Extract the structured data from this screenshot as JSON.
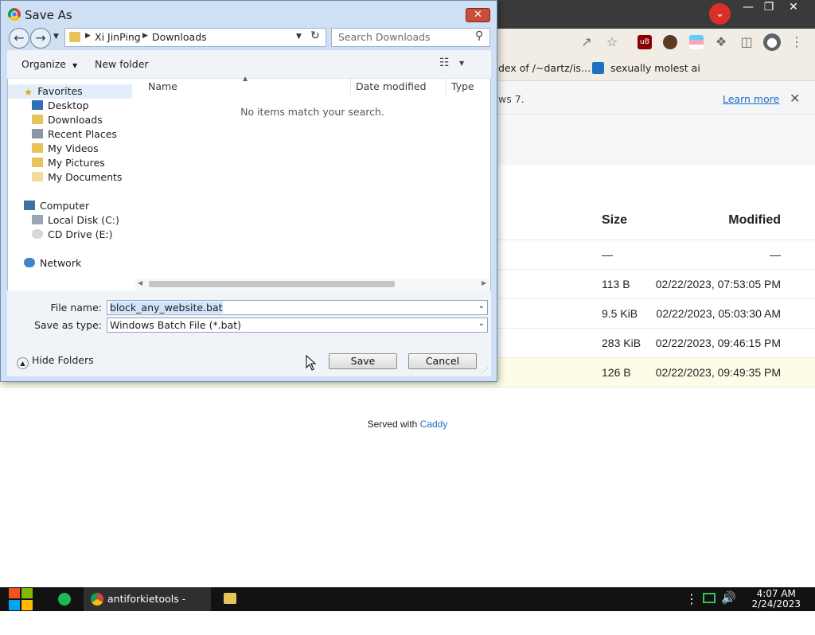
{
  "browser": {
    "bookmarks": [
      "dex of /~dartz/is…",
      "sexually molest ai"
    ],
    "infobar": {
      "text": "ws 7.",
      "link": "Learn more"
    },
    "table": {
      "headers": {
        "size": "Size",
        "modified": "Modified"
      },
      "rows": [
        {
          "size": "—",
          "modified": "—"
        },
        {
          "size": "113 B",
          "modified": "02/22/2023, 07:53:05 PM"
        },
        {
          "size": "9.5 KiB",
          "modified": "02/22/2023, 05:03:30 AM"
        },
        {
          "size": "283 KiB",
          "modified": "02/22/2023, 09:46:15 PM"
        },
        {
          "size": "126 B",
          "modified": "02/22/2023, 09:49:35 PM"
        }
      ]
    },
    "footer": {
      "prefix": "Served with",
      "link": "Caddy"
    }
  },
  "dialog": {
    "title": "Save As",
    "breadcrumb": [
      "Xi JinPing",
      "Downloads"
    ],
    "search_placeholder": "Search Downloads",
    "toolbar": {
      "organize": "Organize",
      "new_folder": "New folder"
    },
    "nav": {
      "favorites": "Favorites",
      "favorite_items": [
        "Desktop",
        "Downloads",
        "Recent Places",
        "My Videos",
        "My Pictures",
        "My Documents"
      ],
      "computer": "Computer",
      "computer_items": [
        "Local Disk (C:)",
        "CD Drive (E:)"
      ],
      "network": "Network"
    },
    "columns": {
      "name": "Name",
      "date_modified": "Date modified",
      "type": "Type"
    },
    "empty_message": "No items match your search.",
    "file_name_label": "File name:",
    "file_name_value": "block_any_website.bat",
    "save_type_label": "Save as type:",
    "save_type_value": "Windows Batch File (*.bat)",
    "hide_folders": "Hide Folders",
    "save": "Save",
    "cancel": "Cancel"
  },
  "taskbar": {
    "chrome_task": "antiforkietools - Go...",
    "time": "4:07 AM",
    "date": "2/24/2023"
  },
  "colors": {
    "dialog_frame": "#cfe0f4",
    "taskbar": "#121212",
    "link": "#1f6fc5",
    "highlight_row": "#fdfde7",
    "profile_red": "#d93025"
  }
}
